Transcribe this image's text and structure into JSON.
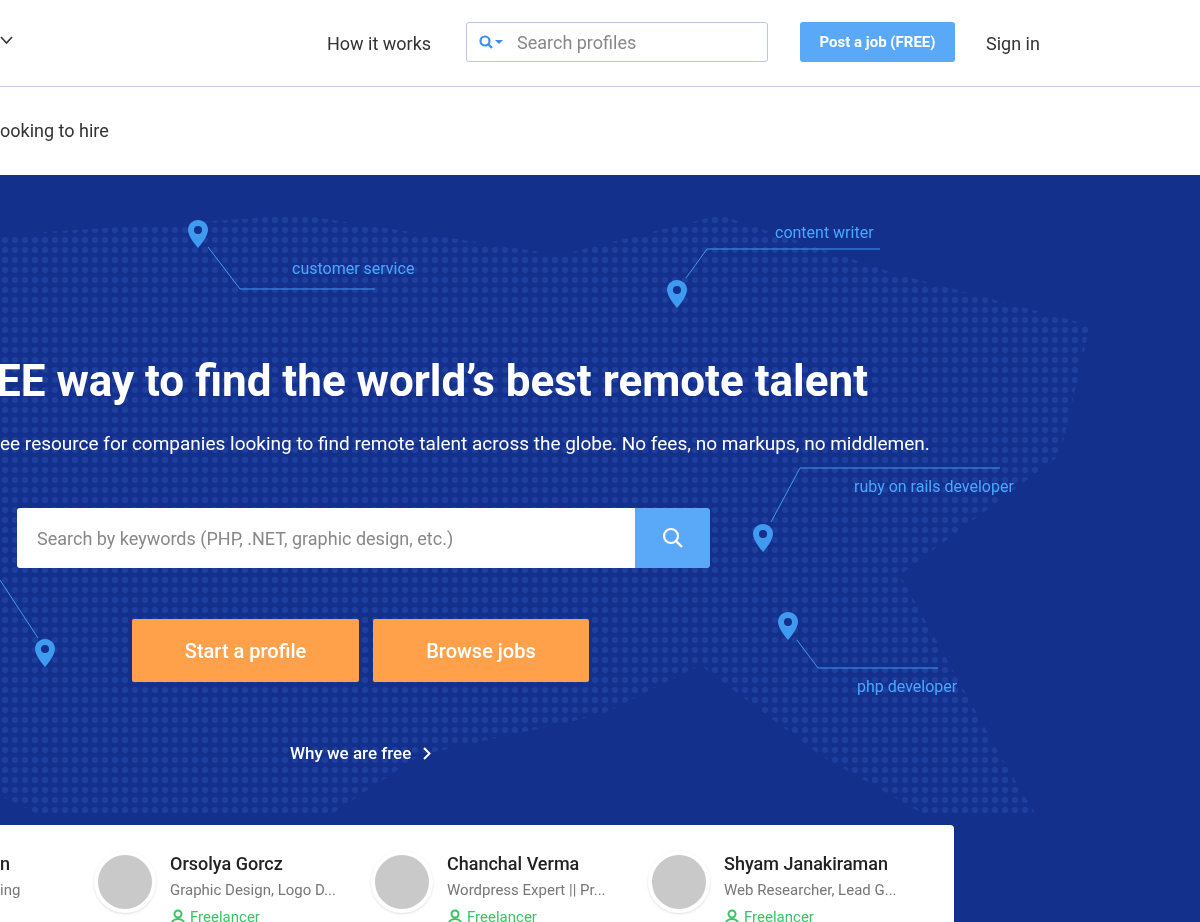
{
  "header": {
    "nav_link": "How it works",
    "search": {
      "placeholder": "Search profiles"
    },
    "post_button": "Post a job (FREE)",
    "sign_in": "Sign in"
  },
  "subheader": {
    "text": "ooking to hire"
  },
  "hero": {
    "title": "EE way to find the world’s best remote talent",
    "subtitle": "ee resource for companies looking to find remote talent across the globe. No fees, no markups, no middlemen.",
    "search": {
      "placeholder": "Search by keywords (PHP, .NET, graphic design, etc.)"
    },
    "buttons": [
      "Start a profile",
      "Browse jobs"
    ],
    "why_link": "Why we are free",
    "pins": [
      {
        "kind": "labeled",
        "label": "customer service"
      },
      {
        "kind": "labeled",
        "label": "content writer"
      },
      {
        "kind": "labeled",
        "label": "ruby on rails developer"
      },
      {
        "kind": "labeled",
        "label": "php developer"
      },
      {
        "kind": "plain"
      }
    ]
  },
  "profiles": {
    "partial": {
      "name": "n",
      "role": "ing"
    },
    "items": [
      {
        "name": "Orsolya Gorcz",
        "role": "Graphic Design, Logo D...",
        "type": "Freelancer"
      },
      {
        "name": "Chanchal Verma",
        "role": "Wordpress Expert || Pr...",
        "type": "Freelancer"
      },
      {
        "name": "Shyam Janakiraman",
        "role": "Web Researcher, Lead G...",
        "type": "Freelancer"
      }
    ]
  }
}
